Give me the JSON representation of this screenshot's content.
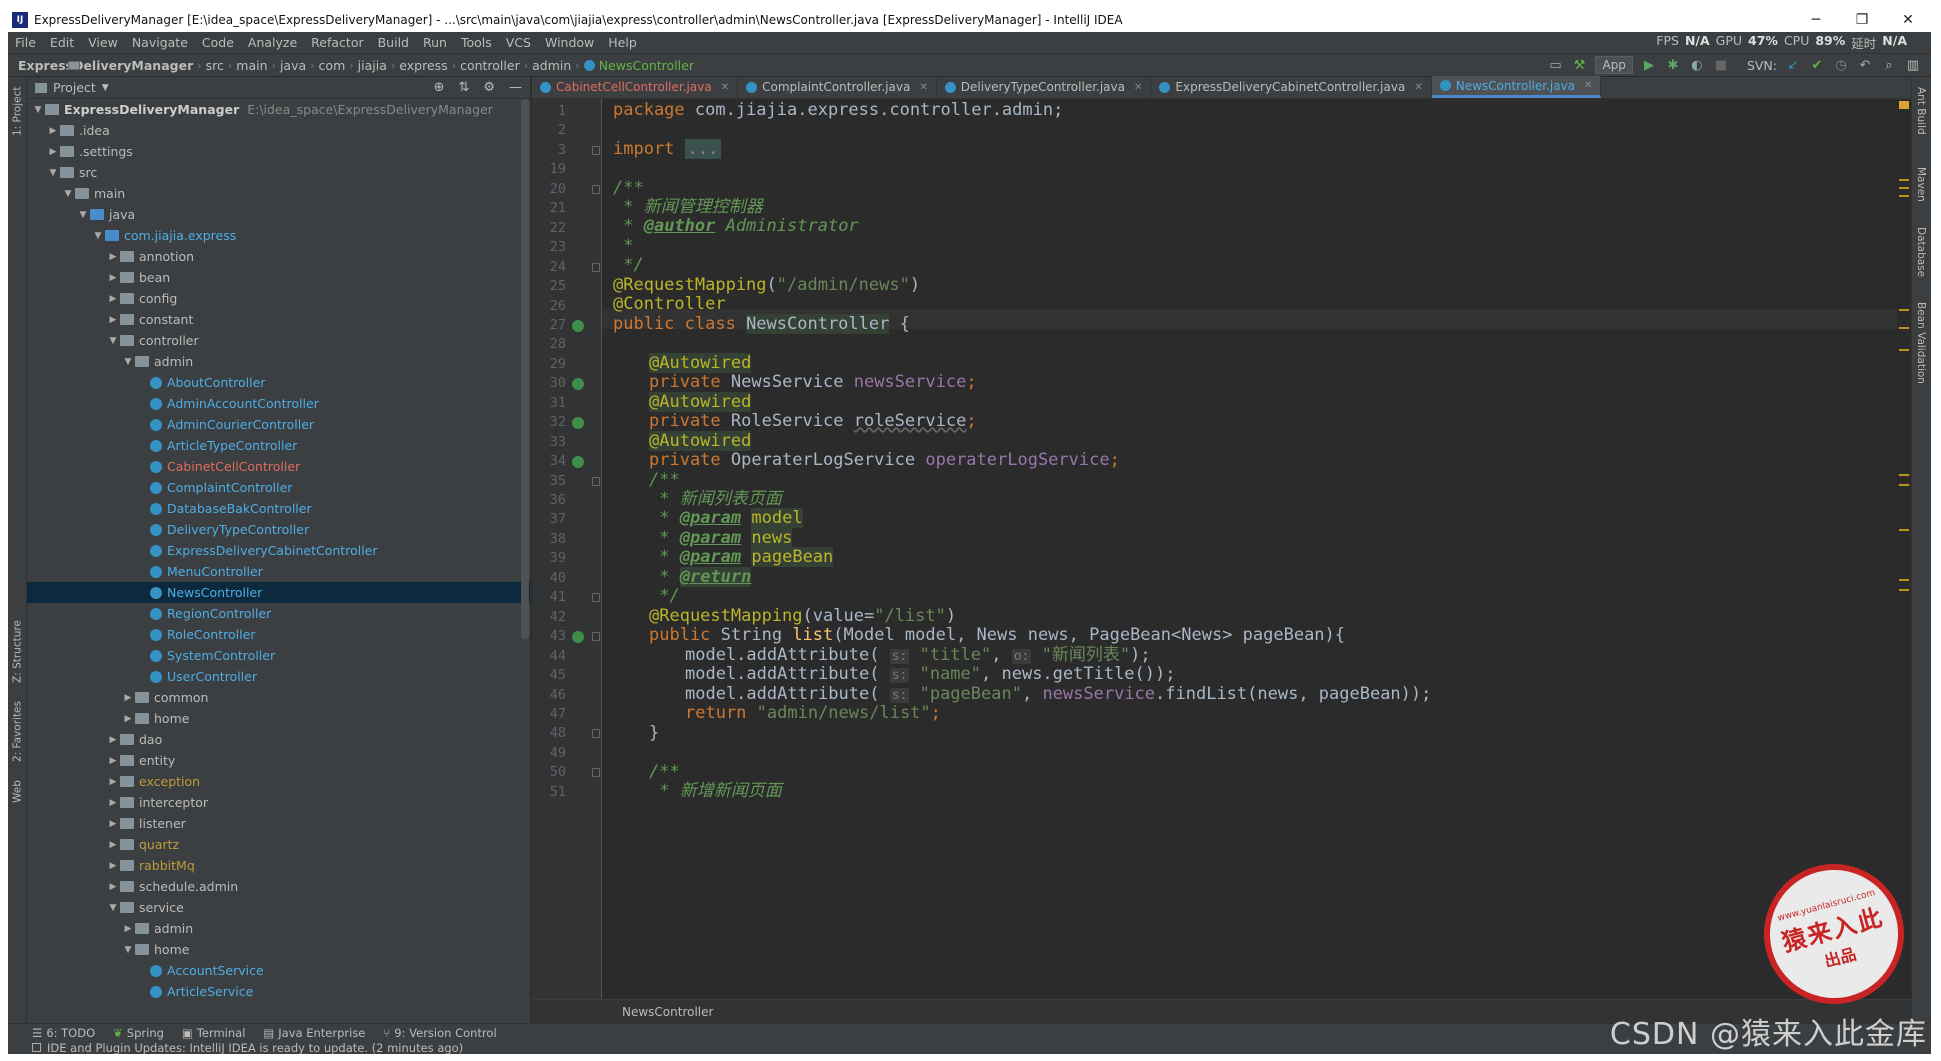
{
  "window": {
    "title": "ExpressDeliveryManager [E:\\idea_space\\ExpressDeliveryManager] - ...\\src\\main\\java\\com\\jiajia\\express\\controller\\admin\\NewsController.java [ExpressDeliveryManager] - IntelliJ IDEA",
    "app_icon": "IJ",
    "min": "─",
    "max": "❐",
    "close": "✕"
  },
  "menu": {
    "items": [
      "File",
      "Edit",
      "View",
      "Navigate",
      "Code",
      "Analyze",
      "Refactor",
      "Build",
      "Run",
      "Tools",
      "VCS",
      "Window",
      "Help"
    ],
    "stats": {
      "fps_label": "FPS",
      "fps": "N/A",
      "gpu_label": "GPU",
      "gpu": "47%",
      "cpu_label": "CPU",
      "cpu": "89%",
      "lat_label": "延时",
      "lat": "N/A"
    }
  },
  "breadcrumbs": [
    "ExpressDeliveryManager",
    "src",
    "main",
    "java",
    "com",
    "jiajia",
    "express",
    "controller",
    "admin",
    "NewsController"
  ],
  "toolbar": {
    "run_config": "App",
    "svn_label": "SVN:"
  },
  "left_tabs": {
    "project": "1: Project",
    "structure": "Z: Structure",
    "favorites": "2: Favorites",
    "web": "Web"
  },
  "right_tabs": {
    "ant": "Ant Build",
    "maven": "Maven",
    "database": "Database",
    "bean": "Bean Validation"
  },
  "project": {
    "header": "Project",
    "tree": [
      {
        "label": "ExpressDeliveryManager",
        "path": "E:\\idea_space\\ExpressDeliveryManager",
        "depth": 0,
        "arrow": "▼",
        "kind": "root"
      },
      {
        "label": ".idea",
        "depth": 1,
        "arrow": "▶",
        "kind": "folder"
      },
      {
        "label": ".settings",
        "depth": 1,
        "arrow": "▶",
        "kind": "folder"
      },
      {
        "label": "src",
        "depth": 1,
        "arrow": "▼",
        "kind": "folder"
      },
      {
        "label": "main",
        "depth": 2,
        "arrow": "▼",
        "kind": "folder"
      },
      {
        "label": "java",
        "depth": 3,
        "arrow": "▼",
        "kind": "src"
      },
      {
        "label": "com.jiajia.express",
        "depth": 4,
        "arrow": "▼",
        "kind": "pkg"
      },
      {
        "label": "annotion",
        "depth": 5,
        "arrow": "▶",
        "kind": "folder"
      },
      {
        "label": "bean",
        "depth": 5,
        "arrow": "▶",
        "kind": "folder"
      },
      {
        "label": "config",
        "depth": 5,
        "arrow": "▶",
        "kind": "folder"
      },
      {
        "label": "constant",
        "depth": 5,
        "arrow": "▶",
        "kind": "folder"
      },
      {
        "label": "controller",
        "depth": 5,
        "arrow": "▼",
        "kind": "folder"
      },
      {
        "label": "admin",
        "depth": 6,
        "arrow": "▼",
        "kind": "folder"
      },
      {
        "label": "AboutController",
        "depth": 7,
        "kind": "class"
      },
      {
        "label": "AdminAccountController",
        "depth": 7,
        "kind": "class"
      },
      {
        "label": "AdminCourierController",
        "depth": 7,
        "kind": "class"
      },
      {
        "label": "ArticleTypeController",
        "depth": 7,
        "kind": "class"
      },
      {
        "label": "CabinetCellController",
        "depth": 7,
        "kind": "class-red"
      },
      {
        "label": "ComplaintController",
        "depth": 7,
        "kind": "class"
      },
      {
        "label": "DatabaseBakController",
        "depth": 7,
        "kind": "class"
      },
      {
        "label": "DeliveryTypeController",
        "depth": 7,
        "kind": "class"
      },
      {
        "label": "ExpressDeliveryCabinetController",
        "depth": 7,
        "kind": "class"
      },
      {
        "label": "MenuController",
        "depth": 7,
        "kind": "class"
      },
      {
        "label": "NewsController",
        "depth": 7,
        "kind": "class",
        "selected": true
      },
      {
        "label": "RegionController",
        "depth": 7,
        "kind": "class"
      },
      {
        "label": "RoleController",
        "depth": 7,
        "kind": "class"
      },
      {
        "label": "SystemController",
        "depth": 7,
        "kind": "class"
      },
      {
        "label": "UserController",
        "depth": 7,
        "kind": "class"
      },
      {
        "label": "common",
        "depth": 6,
        "arrow": "▶",
        "kind": "folder"
      },
      {
        "label": "home",
        "depth": 6,
        "arrow": "▶",
        "kind": "folder"
      },
      {
        "label": "dao",
        "depth": 5,
        "arrow": "▶",
        "kind": "folder"
      },
      {
        "label": "entity",
        "depth": 5,
        "arrow": "▶",
        "kind": "folder"
      },
      {
        "label": "exception",
        "depth": 5,
        "arrow": "▶",
        "kind": "folder-exc"
      },
      {
        "label": "interceptor",
        "depth": 5,
        "arrow": "▶",
        "kind": "folder"
      },
      {
        "label": "listener",
        "depth": 5,
        "arrow": "▶",
        "kind": "folder"
      },
      {
        "label": "quartz",
        "depth": 5,
        "arrow": "▶",
        "kind": "folder-exc"
      },
      {
        "label": "rabbitMq",
        "depth": 5,
        "arrow": "▶",
        "kind": "folder-exc"
      },
      {
        "label": "schedule.admin",
        "depth": 5,
        "arrow": "▶",
        "kind": "folder"
      },
      {
        "label": "service",
        "depth": 5,
        "arrow": "▼",
        "kind": "folder"
      },
      {
        "label": "admin",
        "depth": 6,
        "arrow": "▶",
        "kind": "folder"
      },
      {
        "label": "home",
        "depth": 6,
        "arrow": "▼",
        "kind": "folder"
      },
      {
        "label": "AccountService",
        "depth": 7,
        "kind": "class"
      },
      {
        "label": "ArticleService",
        "depth": 7,
        "kind": "class"
      }
    ]
  },
  "tabs": [
    {
      "label": "CabinetCellController.java",
      "style": "red"
    },
    {
      "label": "ComplaintController.java"
    },
    {
      "label": "DeliveryTypeController.java"
    },
    {
      "label": "ExpressDeliveryCabinetController.java"
    },
    {
      "label": "NewsController.java",
      "active": true
    }
  ],
  "editor": {
    "breadcrumb": "NewsController",
    "line_numbers": [
      "1",
      "2",
      "3",
      "19",
      "20",
      "21",
      "22",
      "23",
      "24",
      "25",
      "26",
      "27",
      "28",
      "29",
      "30",
      "31",
      "32",
      "33",
      "34",
      "35",
      "36",
      "37",
      "38",
      "39",
      "40",
      "41",
      "42",
      "43",
      "44",
      "45",
      "46",
      "47",
      "48",
      "49",
      "50",
      "51"
    ],
    "code": {
      "l1_kw": "package",
      "l1_rest": " com.jiajia.express.controller.admin;",
      "l3_kw": "import",
      "l3_fold": "...",
      "l20": "/**",
      "l21": " * 新闻管理控制器",
      "l22_star": " * ",
      "l22_tag": "@author",
      "l22_rest": " Administrator",
      "l23": " *",
      "l24": " */",
      "l25_an": "@RequestMapping",
      "l25_open": "(",
      "l25_str": "\"/admin/news\"",
      "l25_close": ")",
      "l26": "@Controller",
      "l27_kw": "public class ",
      "l27_name": "NewsController",
      "l27_rest": " {",
      "aw": "@Autowired",
      "l30_kw": "private ",
      "l30_type": "NewsService ",
      "l30_fld": "newsService",
      "semi": ";",
      "l32_kw": "private ",
      "l32_type": "RoleService ",
      "l32_fld": "roleService",
      "l34_kw": "private ",
      "l34_type": "OperaterLogService ",
      "l34_fld": "operaterLogService",
      "l35": "/**",
      "l36": " * 新闻列表页面",
      "star": " * ",
      "param": "@param",
      "p_model": "model",
      "p_news": "news",
      "p_pagebean": "pageBean",
      "ret": "@return",
      "l41": " */",
      "l42_an": "@RequestMapping",
      "l42_a": "(value=",
      "l42_str": "\"/list\"",
      "l42_b": ")",
      "l43_kw": "public ",
      "l43_a": "String ",
      "l43_fn": "list",
      "l43_b": "(Model model, News news, PageBean<News> pageBean){",
      "l44_a": "model.addAttribute( ",
      "l44_h1": "s:",
      "l44_s1": " \"title\"",
      "l44_c": ", ",
      "l44_h2": "o:",
      "l44_s2": " \"新闻列表\"",
      "l44_e": ");",
      "l45_a": "model.addAttribute( ",
      "l45_h": "s:",
      "l45_s": " \"name\"",
      "l45_e": ", news.getTitle());",
      "l46_a": "model.addAttribute( ",
      "l46_h": "s:",
      "l46_s": " \"pageBean\"",
      "l46_c": ", ",
      "l46_f": "newsService",
      "l46_e": ".findList(news, pageBean));",
      "l47_kw": "return ",
      "l47_s": "\"admin/news/list\"",
      "l47_e": ";",
      "l48": "}",
      "l50": "/**",
      "l51": " * 新增新闻页面"
    }
  },
  "bottom": {
    "todo": "6: TODO",
    "spring": "Spring",
    "terminal": "Terminal",
    "javaee": "Java Enterprise",
    "vc": "9: Version Control"
  },
  "status": {
    "text": "IDE and Plugin Updates: IntelliJ IDEA is ready to update. (2 minutes ago)"
  },
  "watermark": {
    "text": "CSDN @猿来入此金库"
  },
  "stamp": {
    "top": "www.yuanlaisruci.com",
    "mid": "猿来入此",
    "bot": "出品"
  },
  "colors": {
    "bg": "#2b2b2b",
    "panel": "#3c3f41",
    "keyword": "#cc7832",
    "annotation": "#bbb529",
    "string": "#6a8759",
    "field": "#9876aa",
    "comment": "#629755",
    "class": "#4eade5",
    "selected": "#0d293e"
  }
}
